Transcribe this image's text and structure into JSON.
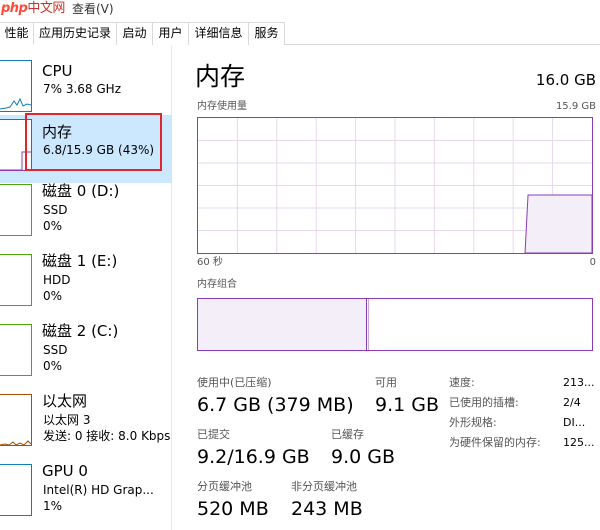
{
  "menubar": {
    "watermark_latin": "php",
    "watermark_cn": "中文网",
    "view_menu": "查看(V)"
  },
  "tabs": [
    {
      "label": "性能"
    },
    {
      "label": "应用历史记录"
    },
    {
      "label": "启动"
    },
    {
      "label": "用户"
    },
    {
      "label": "详细信息"
    },
    {
      "label": "服务"
    }
  ],
  "active_tab": "性能",
  "sidebar": {
    "items": [
      {
        "title": "CPU",
        "lines": [
          "7% 3.68 GHz"
        ],
        "color": "#117dbb"
      },
      {
        "title": "内存",
        "lines": [
          "6.8/15.9 GB (43%)"
        ],
        "color": "#8b3cb4"
      },
      {
        "title": "磁盘 0 (D:)",
        "lines": [
          "SSD",
          "0%"
        ],
        "color": "#4da60c"
      },
      {
        "title": "磁盘 1 (E:)",
        "lines": [
          "HDD",
          "0%"
        ],
        "color": "#4da60c"
      },
      {
        "title": "磁盘 2 (C:)",
        "lines": [
          "SSD",
          "0%"
        ],
        "color": "#4da60c"
      },
      {
        "title": "以太网",
        "lines": [
          "以太网 3",
          "发送: 0 接收: 8.0 Kbps"
        ],
        "color": "#a74f01"
      },
      {
        "title": "GPU 0",
        "lines": [
          "Intel(R) HD Grap...",
          "1%"
        ],
        "color": "#117dbb"
      }
    ],
    "selected_index": 1
  },
  "memory": {
    "title": "内存",
    "total": "16.0 GB",
    "usage_label": "内存使用量",
    "usage_max": "15.9 GB",
    "time_left": "60 秒",
    "time_right": "0",
    "composition_label": "内存组合",
    "usage_fraction": 0.43,
    "composition": {
      "in_use_fraction": 0.43,
      "modified_fraction": 0.005
    },
    "accent_color": "#8b3cb4",
    "stats": {
      "in_use_label": "使用中(已压缩)",
      "in_use_value": "6.7 GB (379 MB)",
      "available_label": "可用",
      "available_value": "9.1 GB",
      "committed_label": "已提交",
      "committed_value": "9.2/16.9 GB",
      "cached_label": "已缓存",
      "cached_value": "9.0 GB",
      "paged_pool_label": "分页缓冲池",
      "paged_pool_value": "520 MB",
      "nonpaged_pool_label": "非分页缓冲池",
      "nonpaged_pool_value": "243 MB"
    },
    "specs": [
      {
        "key": "速度:",
        "value": "213..."
      },
      {
        "key": "已使用的插槽:",
        "value": "2/4"
      },
      {
        "key": "外形规格:",
        "value": "DI..."
      },
      {
        "key": "为硬件保留的内存:",
        "value": "125..."
      }
    ]
  }
}
